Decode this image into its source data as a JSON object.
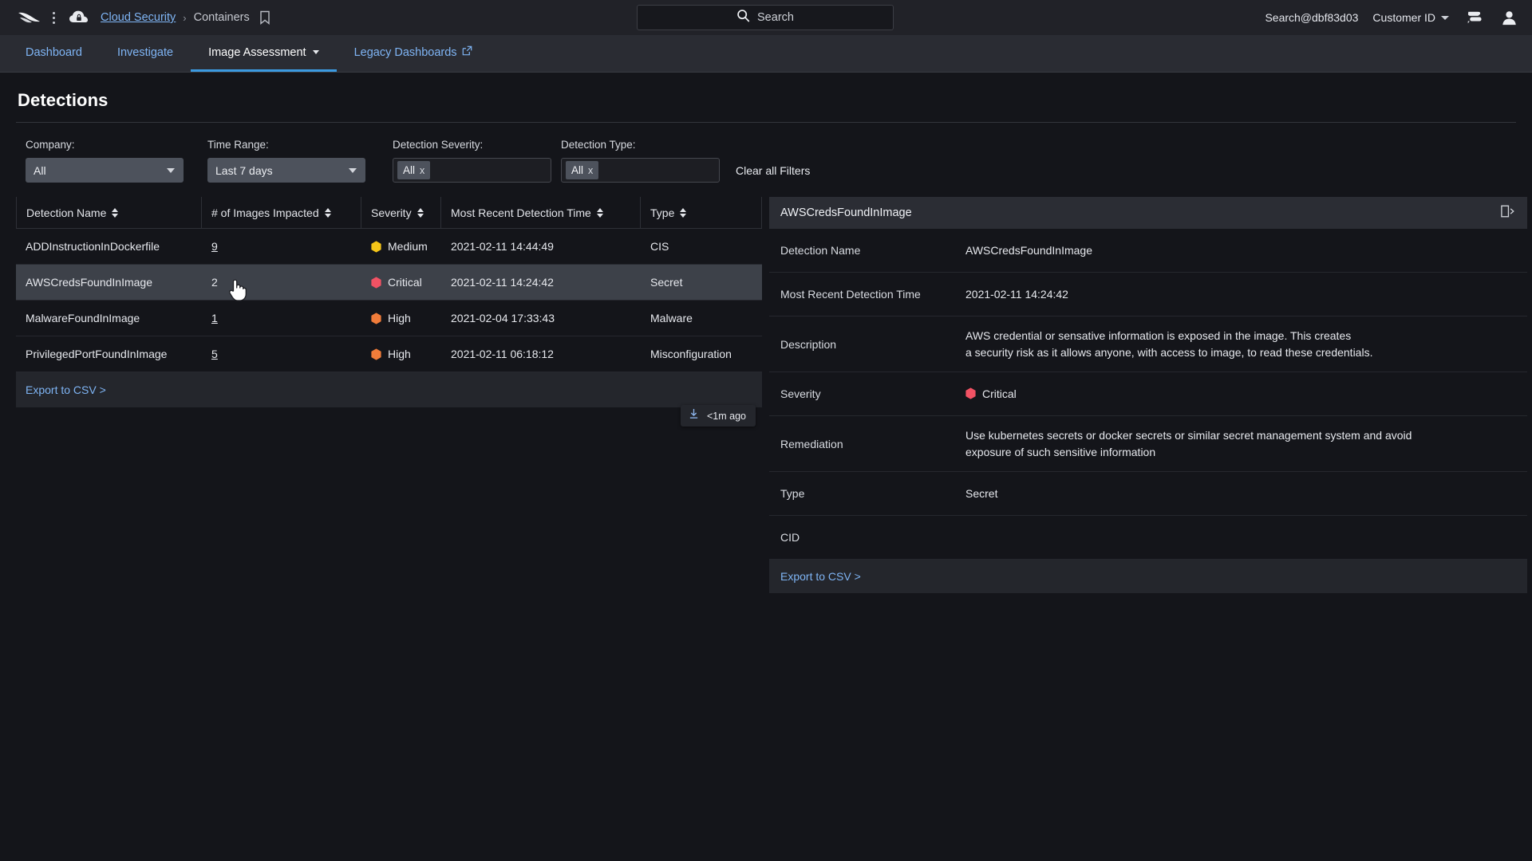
{
  "topbar": {
    "logo_icon": "falcon-logo-icon",
    "kebab_icon": "kebab-menu-icon",
    "cloud_icon": "cloud-security-icon",
    "breadcrumb": {
      "root": "Cloud Security",
      "separator": "›",
      "current": "Containers"
    },
    "bookmark_icon": "bookmark-icon",
    "search": {
      "icon": "search-icon",
      "placeholder": "Search",
      "value": ""
    },
    "user_label": "Search@dbf83d03",
    "customer_id_label": "Customer ID",
    "chevron_icon": "chevron-down-icon",
    "notes_icon": "notes-icon",
    "avatar_icon": "user-avatar-icon"
  },
  "nav": {
    "tabs": [
      {
        "label": "Dashboard",
        "active": false,
        "dropdown": false,
        "external": false
      },
      {
        "label": "Investigate",
        "active": false,
        "dropdown": false,
        "external": false
      },
      {
        "label": "Image Assessment",
        "active": true,
        "dropdown": true,
        "external": false
      },
      {
        "label": "Legacy Dashboards",
        "active": false,
        "dropdown": false,
        "external": true
      }
    ]
  },
  "page": {
    "title": "Detections"
  },
  "filters": {
    "company": {
      "label": "Company:",
      "value": "All"
    },
    "time_range": {
      "label": "Time Range:",
      "value": "Last 7 days"
    },
    "detection_severity": {
      "label": "Detection Severity:",
      "token": "All",
      "remove_icon": "x"
    },
    "detection_type": {
      "label": "Detection Type:",
      "token": "All",
      "remove_icon": "x"
    },
    "clear_all": "Clear all Filters"
  },
  "table": {
    "columns": [
      {
        "label": "Detection Name",
        "sortable": true
      },
      {
        "label": "# of Images Impacted",
        "sortable": true
      },
      {
        "label": "Severity",
        "sortable": true
      },
      {
        "label": "Most Recent Detection Time",
        "sortable": true
      },
      {
        "label": "Type",
        "sortable": true
      }
    ],
    "rows": [
      {
        "name": "ADDInstructionInDockerfile",
        "images": "9",
        "images_link": true,
        "severity": "Medium",
        "severity_color": "#f5c518",
        "time": "2021-02-11 14:44:49",
        "type": "CIS",
        "selected": false
      },
      {
        "name": "AWSCredsFoundInImage",
        "images": "2",
        "images_link": false,
        "severity": "Critical",
        "severity_color": "#f25264",
        "time": "2021-02-11 14:24:42",
        "type": "Secret",
        "selected": true
      },
      {
        "name": "MalwareFoundInImage",
        "images": "1",
        "images_link": true,
        "severity": "High",
        "severity_color": "#f07c3a",
        "time": "2021-02-04 17:33:43",
        "type": "Malware",
        "selected": false
      },
      {
        "name": "PrivilegedPortFoundInImage",
        "images": "5",
        "images_link": true,
        "severity": "High",
        "severity_color": "#f07c3a",
        "time": "2021-02-11 06:18:12",
        "type": "Misconfiguration",
        "selected": false
      }
    ],
    "export_label": "Export to CSV >"
  },
  "download_toast": {
    "icon": "download-icon",
    "label": "<1m ago"
  },
  "detail_panel": {
    "title": "AWSCredsFoundInImage",
    "expand_icon": "expand-panel-icon",
    "rows": [
      {
        "label": "Detection Name",
        "value": "AWSCredsFoundInImage"
      },
      {
        "label": "Most Recent Detection Time",
        "value": "2021-02-11 14:24:42"
      },
      {
        "label": "Description",
        "value": "AWS credential or sensative information is exposed in the image. This creates\na security risk as it allows anyone, with access to image, to read these credentials."
      },
      {
        "label": "Severity",
        "value": "Critical",
        "severity_color": "#f25264"
      },
      {
        "label": "Remediation",
        "value": "Use kubernetes secrets or docker secrets or similar secret management system and avoid\nexposure of such sensitive information"
      },
      {
        "label": "Type",
        "value": "Secret"
      },
      {
        "label": "CID",
        "value": ""
      }
    ],
    "export_label": "Export to CSV >"
  },
  "colors": {
    "accent_link": "#7fb5f5",
    "tab_underline": "#3b9ae1",
    "critical": "#f25264",
    "high": "#f07c3a",
    "medium": "#f5c518",
    "row_selected": "#3d4149"
  }
}
